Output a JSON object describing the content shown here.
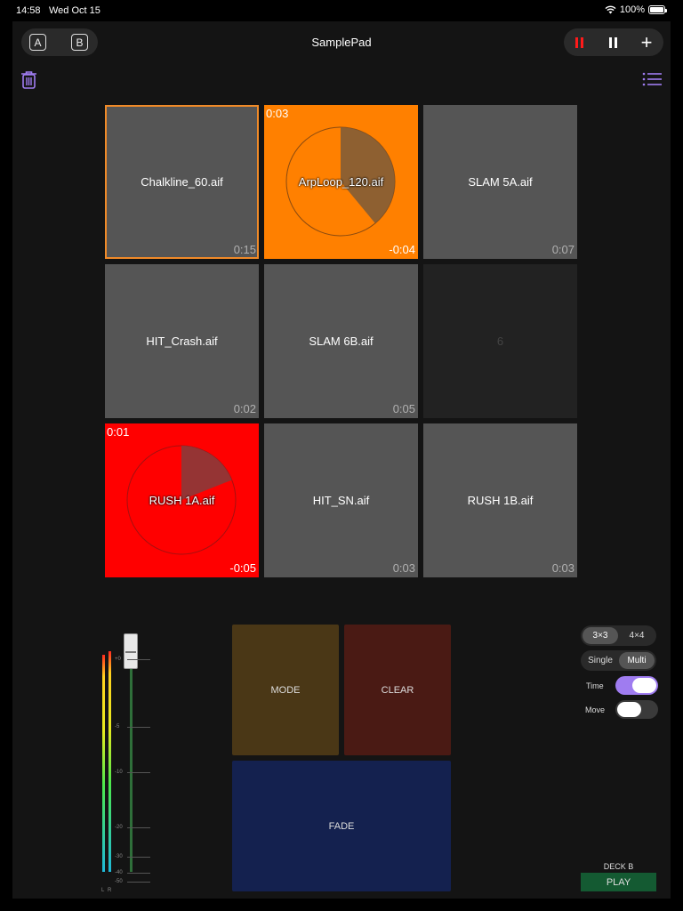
{
  "status": {
    "time": "14:58",
    "date": "Wed Oct 15",
    "battery": "100%"
  },
  "header": {
    "title": "SamplePad",
    "deck_a": "A",
    "deck_b": "B",
    "add": "+",
    "colors": {
      "rec": "#ff1a1a",
      "accent": "#9f7cf0"
    }
  },
  "pads": [
    {
      "name": "Chalkline_60.aif",
      "duration": "0:15",
      "state": "selected"
    },
    {
      "name": "ArpLoop_120.aif",
      "elapsed": "0:03",
      "remaining": "-0:04",
      "state": "playing",
      "color": "#ff8000",
      "progress": 0.39
    },
    {
      "name": "SLAM 5A.aif",
      "duration": "0:07",
      "state": "idle"
    },
    {
      "name": "HIT_Crash.aif",
      "duration": "0:02",
      "state": "idle"
    },
    {
      "name": "SLAM 6B.aif",
      "duration": "0:05",
      "state": "idle"
    },
    {
      "name": "6",
      "state": "empty"
    },
    {
      "name": "RUSH 1A.aif",
      "elapsed": "0:01",
      "remaining": "-0:05",
      "state": "playing",
      "color": "#ff0000",
      "progress": 0.19
    },
    {
      "name": "HIT_SN.aif",
      "duration": "0:03",
      "state": "idle"
    },
    {
      "name": "RUSH 1B.aif",
      "duration": "0:03",
      "state": "idle"
    }
  ],
  "meter": {
    "ticks": [
      "+0",
      "-5",
      "-10",
      "-20",
      "-30",
      "-40",
      "-50",
      "-∞"
    ],
    "left": "L",
    "right": "R"
  },
  "actions": {
    "mode": "MODE",
    "clear": "CLEAR",
    "fade": "FADE"
  },
  "controls": {
    "grid": {
      "options": [
        "3×3",
        "4×4"
      ],
      "selected": "3×3"
    },
    "mode": {
      "options": [
        "Single",
        "Multi"
      ],
      "selected": "Multi"
    },
    "time_label": "Time",
    "time_on": true,
    "move_label": "Move",
    "move_on": false,
    "deck_label": "DECK B",
    "play_label": "PLAY"
  }
}
